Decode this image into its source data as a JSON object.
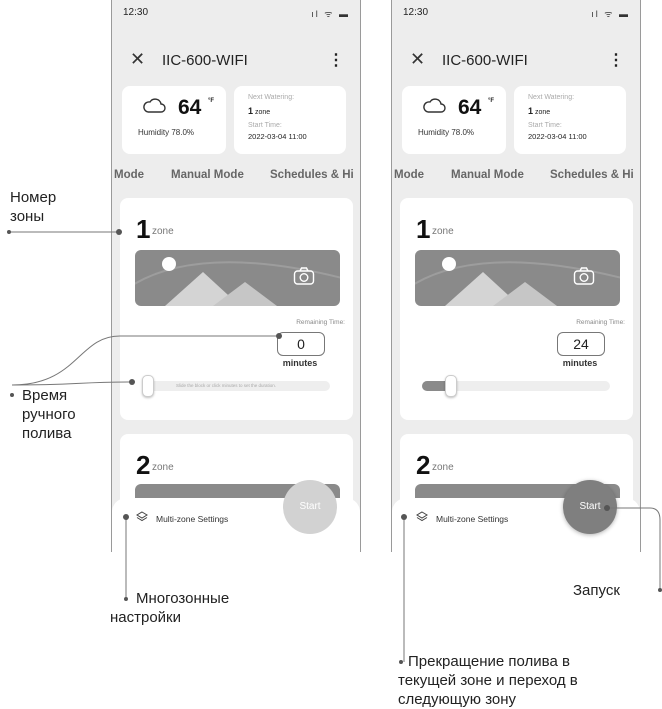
{
  "status_bar": {
    "time": "12:30",
    "icons": "ıl ᯤ ▬"
  },
  "header": {
    "title": "IIC-600-WIFI",
    "close_icon": "close-icon",
    "menu_icon": "kebab-menu-icon"
  },
  "weather": {
    "temperature": "64",
    "unit": "°F",
    "humidity": "Humidity 78.0%"
  },
  "next_watering": {
    "label": "Next Watering:",
    "zone_number": "1",
    "zone_word": "zone",
    "start_label": "Start Time:",
    "start_time": "2022-03-04 11:00"
  },
  "tabs": [
    "Mode",
    "Manual Mode",
    "Schedules & Hi"
  ],
  "zones": [
    {
      "number": "1",
      "word": "zone"
    },
    {
      "number": "2",
      "word": "zone"
    }
  ],
  "remaining_label": "Remaining Time:",
  "minutes_label": "minutes",
  "left_screen": {
    "minutes_value": "0",
    "slider_fraction": 0.0,
    "slider_hint": "Slide the block or click minutes to set the duration."
  },
  "right_screen": {
    "minutes_value": "24",
    "slider_fraction": 0.13
  },
  "bottom_bar": {
    "multizone_label": "Multi-zone Settings",
    "start_label": "Start"
  },
  "annotations": {
    "zone_number": [
      "Номер",
      "зоны"
    ],
    "manual_time": [
      "Время",
      "ручного",
      "полива"
    ],
    "multizone": [
      "Многозонные",
      "настройки"
    ],
    "start": "Запуск",
    "stop": [
      "Прекращение полива в",
      "текущей зоне и переход в",
      "следующую зону"
    ]
  },
  "colors": {
    "phone_bg": "#ededed",
    "image_placeholder": "#8a8a8a",
    "start_active": "#7f7f7f",
    "start_inactive": "#d2d2d2"
  }
}
